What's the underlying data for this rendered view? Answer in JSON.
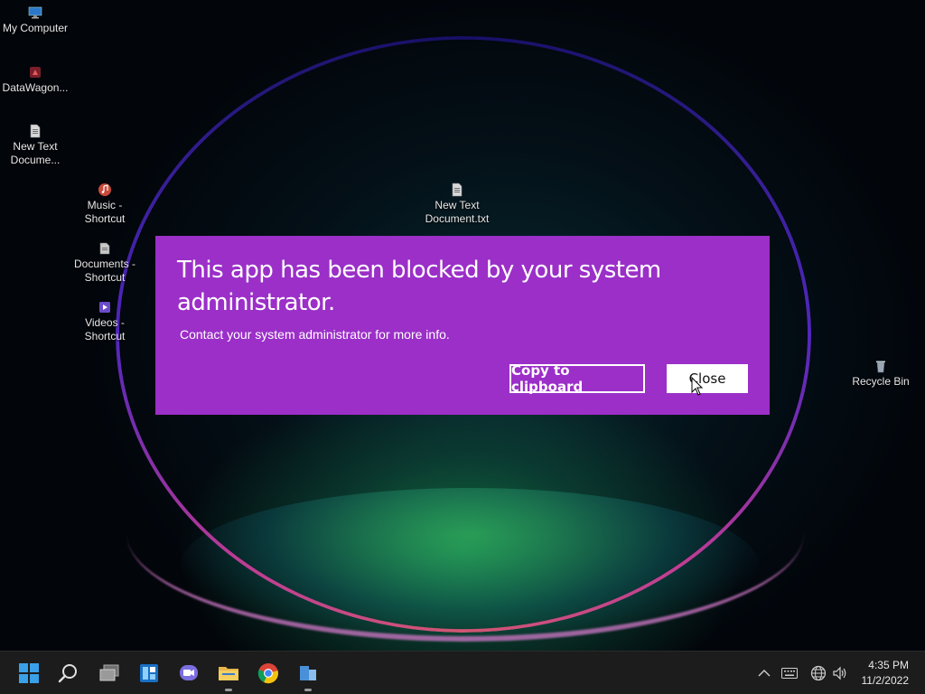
{
  "desktop": {
    "icons": [
      {
        "label": "My Computer",
        "icon": "monitor-icon"
      },
      {
        "label": "DataWagon...",
        "icon": "app-icon"
      },
      {
        "label": "New Text Docume...",
        "icon": "text-file-icon"
      },
      {
        "label": "Music - Shortcut",
        "icon": "music-folder-icon"
      },
      {
        "label": "Documents - Shortcut",
        "icon": "documents-folder-icon"
      },
      {
        "label": "Videos - Shortcut",
        "icon": "videos-folder-icon"
      },
      {
        "label": "New Text Document.txt",
        "icon": "text-file-icon"
      },
      {
        "label": "Recycle Bin",
        "icon": "recycle-bin-icon"
      }
    ]
  },
  "dialog": {
    "title": "This app has been blocked by your system administrator.",
    "message": "Contact your system administrator for more info.",
    "copy_label": "Copy to clipboard",
    "close_label": "Close",
    "background": "#9b2fc8"
  },
  "taskbar": {
    "apps": [
      "start-icon",
      "search-icon",
      "task-view-icon",
      "widgets-icon",
      "teams-chat-icon",
      "file-explorer-icon",
      "chrome-icon",
      "app-icon"
    ],
    "time": "4:35 PM",
    "date": "11/2/2022"
  }
}
